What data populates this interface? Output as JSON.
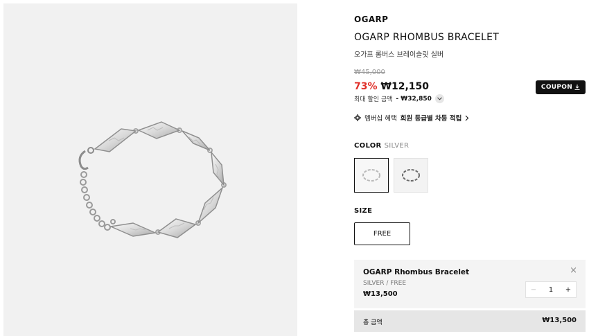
{
  "product": {
    "brand": "OGARP",
    "title": "OGARP RHOMBUS BRACELET",
    "subtitle": "오가프 롬버스 브레이슬릿 실버",
    "image_icon": "bracelet-image"
  },
  "price": {
    "original": "₩45,000",
    "discount_rate": "73%",
    "sale": "₩12,150",
    "coupon_label": "COUPON",
    "max_label": "최대 할인 금액",
    "max_price": "- ₩32,850"
  },
  "membership": {
    "label": "멤버십 혜택",
    "benefit": "회원 등급별 차등 적립"
  },
  "color": {
    "label": "COLOR",
    "selected": "SILVER"
  },
  "size": {
    "label": "SIZE",
    "option": "FREE"
  },
  "selected_item": {
    "name": "OGARP Rhombus Bracelet",
    "option": "SILVER / FREE",
    "price": "₩13,500",
    "quantity": "1"
  },
  "total": {
    "label": "총 금액",
    "price": "₩13,500"
  },
  "colors": {
    "discount": "#e0302a",
    "coupon_bg": "#111111"
  }
}
